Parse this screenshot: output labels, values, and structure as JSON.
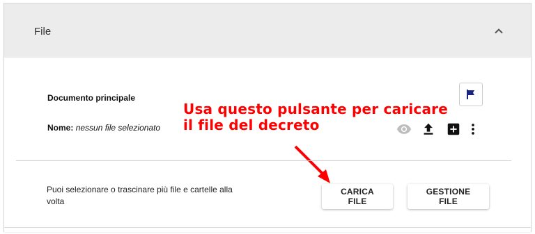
{
  "panel": {
    "title": "File",
    "collapse_icon": "chevron-up-icon"
  },
  "document": {
    "heading": "Documento principale",
    "name_label": "Nome:",
    "name_value": "nessun file selezionato"
  },
  "icons": {
    "flag": "flag-icon",
    "view": "eye-icon",
    "upload": "upload-icon",
    "add": "add-box-icon",
    "more": "more-vert-icon"
  },
  "upload": {
    "help_text": "Puoi selezionare o trascinare più file e cartelle alla volta",
    "load_button": "CARICA FILE",
    "manage_button": "GESTIONE FILE"
  },
  "annotation": {
    "line1": "Usa questo pulsante per caricare",
    "line2": "il file del decreto"
  },
  "colors": {
    "annotation": "#ff0000",
    "flag": "#1a237e",
    "header_bg": "#ececec"
  }
}
